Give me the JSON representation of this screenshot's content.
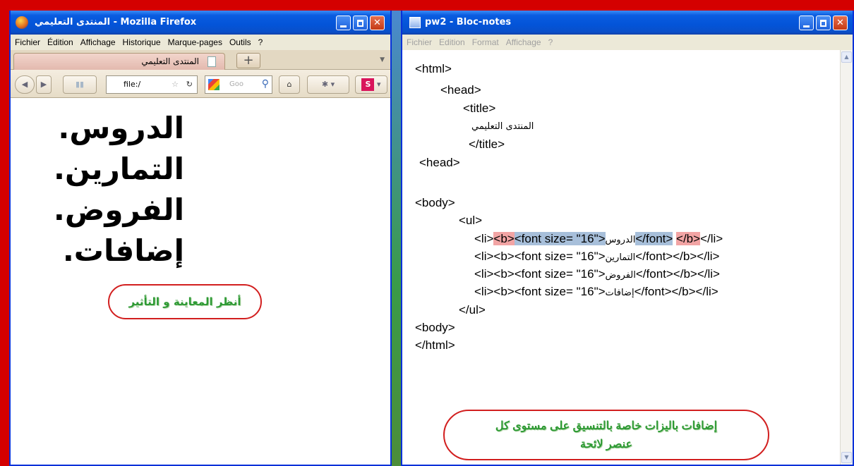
{
  "firefox": {
    "title": "المنتدى التعليمي - Mozilla Firefox",
    "menu": [
      "Fichier",
      "Édition",
      "Affichage",
      "Historique",
      "Marque-pages",
      "Outils",
      "?"
    ],
    "tab_label": "المنتدى التعليمي",
    "new_tab": "+",
    "url": "file:/",
    "search_placeholder": "Goo",
    "page_items": [
      "الدروس.",
      "التمارين.",
      "الفروض.",
      "إضافات."
    ],
    "callout": "أنظر المعاينة و التأثير"
  },
  "notepad": {
    "title": "pw2 - Bloc-notes",
    "menu": [
      "Fichier",
      "Edition",
      "Format",
      "Affichage",
      "?"
    ],
    "code": {
      "html_open": "<html>",
      "head_open": "<head>",
      "title_open": "<title>",
      "title_text": "المنتدى التعليمي",
      "title_close": "</title>",
      "head_close": "<head>",
      "body_open": "<body>",
      "ul_open": "<ul>",
      "li_open": "<li>",
      "b_open": "<b>",
      "font_open": "<font size= \"16\">",
      "font_close": "</font>",
      "b_close": "</b>",
      "li_close": "</li>",
      "items": [
        "الدروس",
        "التمارين",
        "الفروض",
        "إضافات"
      ],
      "ul_close": "</ul>",
      "body_close": "<body>",
      "html_close": "</html>"
    },
    "callout_line1": "إضافات باليزات خاصة بالتنسيق على مستوى كل",
    "callout_line2": "عنصر لائحة"
  },
  "colors": {
    "frame": "#d40000",
    "titlebar": "#0354d8",
    "highlight_red": "#f2a4a4",
    "highlight_blue": "#a7bfda",
    "callout_text": "#2e9a34",
    "callout_border": "#d21f1f"
  }
}
